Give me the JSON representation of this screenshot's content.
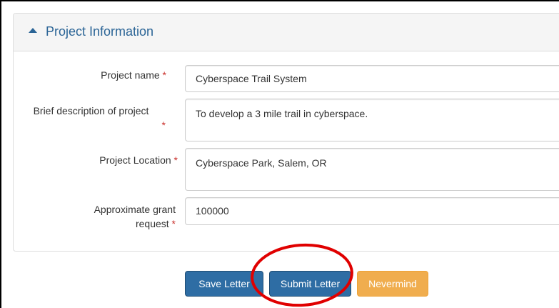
{
  "panel": {
    "title": "Project Information"
  },
  "form": {
    "required_mark": "*",
    "project_name": {
      "label": "Project name",
      "value": "Cyberspace Trail System"
    },
    "description": {
      "label": "Brief description of project",
      "value": "To develop a 3 mile trail in cyberspace."
    },
    "location": {
      "label": "Project Location",
      "value": "Cyberspace Park, Salem, OR"
    },
    "grant": {
      "label_line1": "Approximate grant",
      "label_line2": "request",
      "value": "100000"
    }
  },
  "buttons": {
    "save": "Save Letter",
    "submit": "Submit Letter",
    "nevermind": "Nevermind"
  },
  "colors": {
    "primary": "#2e6da4",
    "warning": "#f0ad4e",
    "heading_text": "#2a6496",
    "required": "#c9302c",
    "annotation": "#e00000"
  },
  "icons": {
    "collapse": "caret-up-icon"
  }
}
